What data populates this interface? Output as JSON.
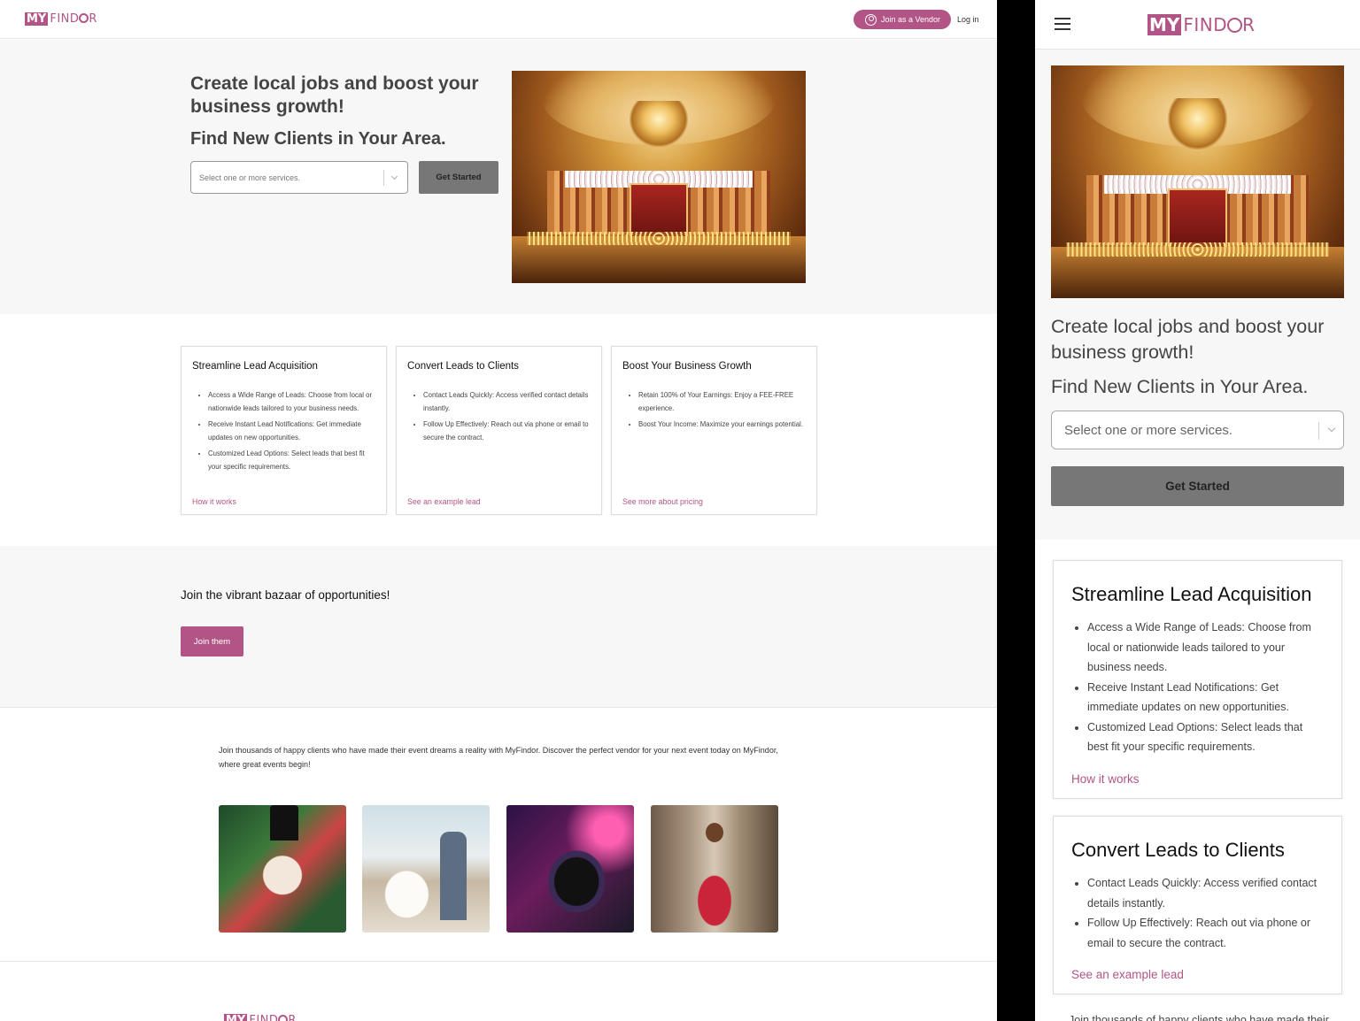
{
  "brand": {
    "logo_my": "MY",
    "logo_findor_pre": "FIND",
    "logo_findor_o": "",
    "logo_findor_post": "R",
    "accent_color": "#b25586"
  },
  "header": {
    "vendor_button": "Join as a Vendor",
    "vendor_icon": "user-circle-icon",
    "login": "Log in"
  },
  "hero": {
    "title": "Create local jobs and boost your business growth!",
    "subtitle": "Find New Clients in Your Area.",
    "select_placeholder": "Select one or more services.",
    "cta": "Get Started"
  },
  "features": [
    {
      "title": "Streamline Lead Acquisition",
      "bullets": [
        "Access a Wide Range of Leads: Choose from local or nationwide leads tailored to your business needs.",
        "Receive Instant Lead Notifications: Get immediate updates on new opportunities.",
        "Customized Lead Options: Select leads that best fit your specific requirements."
      ],
      "link": "How it works"
    },
    {
      "title": "Convert Leads to Clients",
      "bullets": [
        "Contact Leads Quickly: Access verified contact details instantly.",
        "Follow Up Effectively: Reach out via phone or email to secure the contract."
      ],
      "link": "See an example lead"
    },
    {
      "title": "Boost Your Business Growth",
      "bullets": [
        "Retain 100% of Your Earnings: Enjoy a FEE-FREE experience.",
        "Boost Your Income: Maximize your earnings potential."
      ],
      "link": "See more about pricing"
    }
  ],
  "join": {
    "heading": "Join the vibrant bazaar of opportunities!",
    "button": "Join them"
  },
  "clients": {
    "text": "Join thousands of happy clients who have made their event dreams a reality with MyFindor. Discover the perfect vendor for your next event today on MyFindor, where great events begin!"
  },
  "mobile": {
    "menu_icon": "hamburger-menu-icon",
    "cut_text": "Join thousands of happy clients who have made their"
  }
}
